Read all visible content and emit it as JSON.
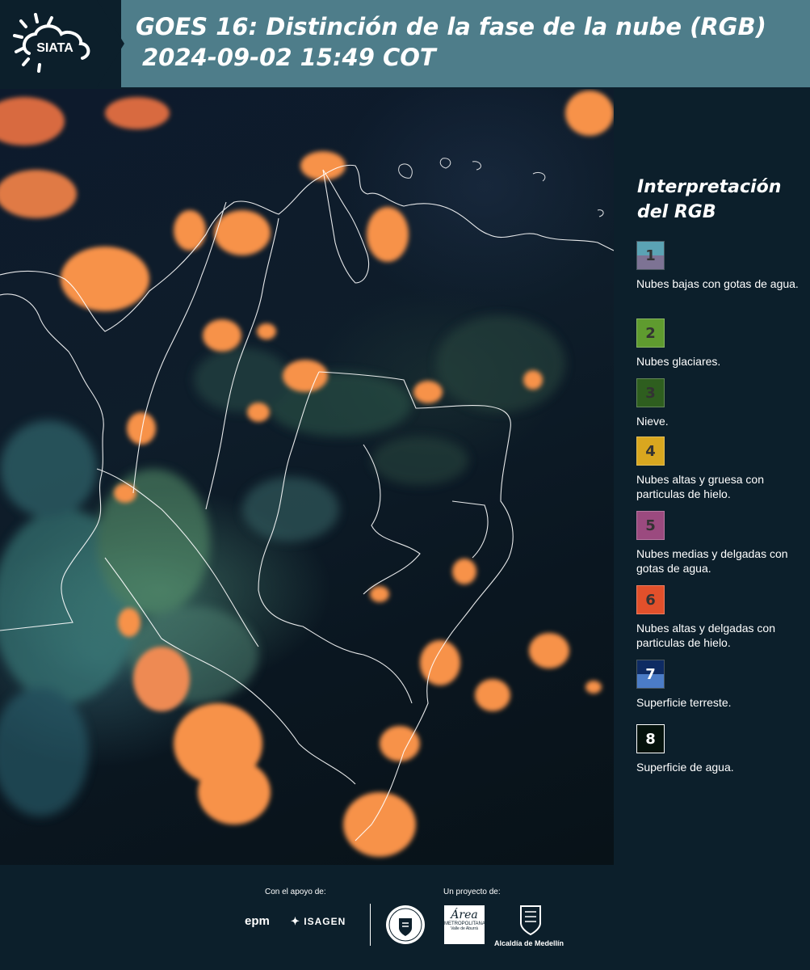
{
  "header": {
    "logo_text": "SIATA",
    "title_line1": "GOES 16: Distinción de la fase de la nube (RGB)",
    "title_line2": "2024-09-02 15:49 COT"
  },
  "legend": {
    "title": "Interpretación del RGB",
    "items": [
      {
        "number": "1",
        "label": "Nubes bajas con gotas de agua.",
        "color_top": "#5ba3b4",
        "color_bottom": "#7d7394"
      },
      {
        "number": "2",
        "label": "Nubes glaciares.",
        "color": "#5f9b2f"
      },
      {
        "number": "3",
        "label": "Nieve.",
        "color": "#2e5e1f"
      },
      {
        "number": "4",
        "label": "Nubes altas y gruesa con particulas de hielo.",
        "color": "#d9a71f"
      },
      {
        "number": "5",
        "label": "Nubes medias y delgadas con gotas de agua.",
        "color": "#9b4a7f"
      },
      {
        "number": "6",
        "label": "Nubes altas y delgadas con particulas de hielo.",
        "color": "#e2502b"
      },
      {
        "number": "7",
        "label": "Superficie terreste.",
        "color_top": "#0e2b63",
        "color_bottom": "#4b7cc7"
      },
      {
        "number": "8",
        "label": "Superficie de agua.",
        "color": "#05120c"
      }
    ]
  },
  "footer": {
    "support_label": "Con el apoyo de:",
    "project_label": "Un proyecto de:",
    "sponsor_epm": "epm",
    "sponsor_isagen": "ISAGEN",
    "area_text": "Área",
    "area_sub": "METROPOLITANA",
    "area_sub2": "Valle de Aburrá",
    "alcaldia": "Alcaldía de Medellín"
  }
}
